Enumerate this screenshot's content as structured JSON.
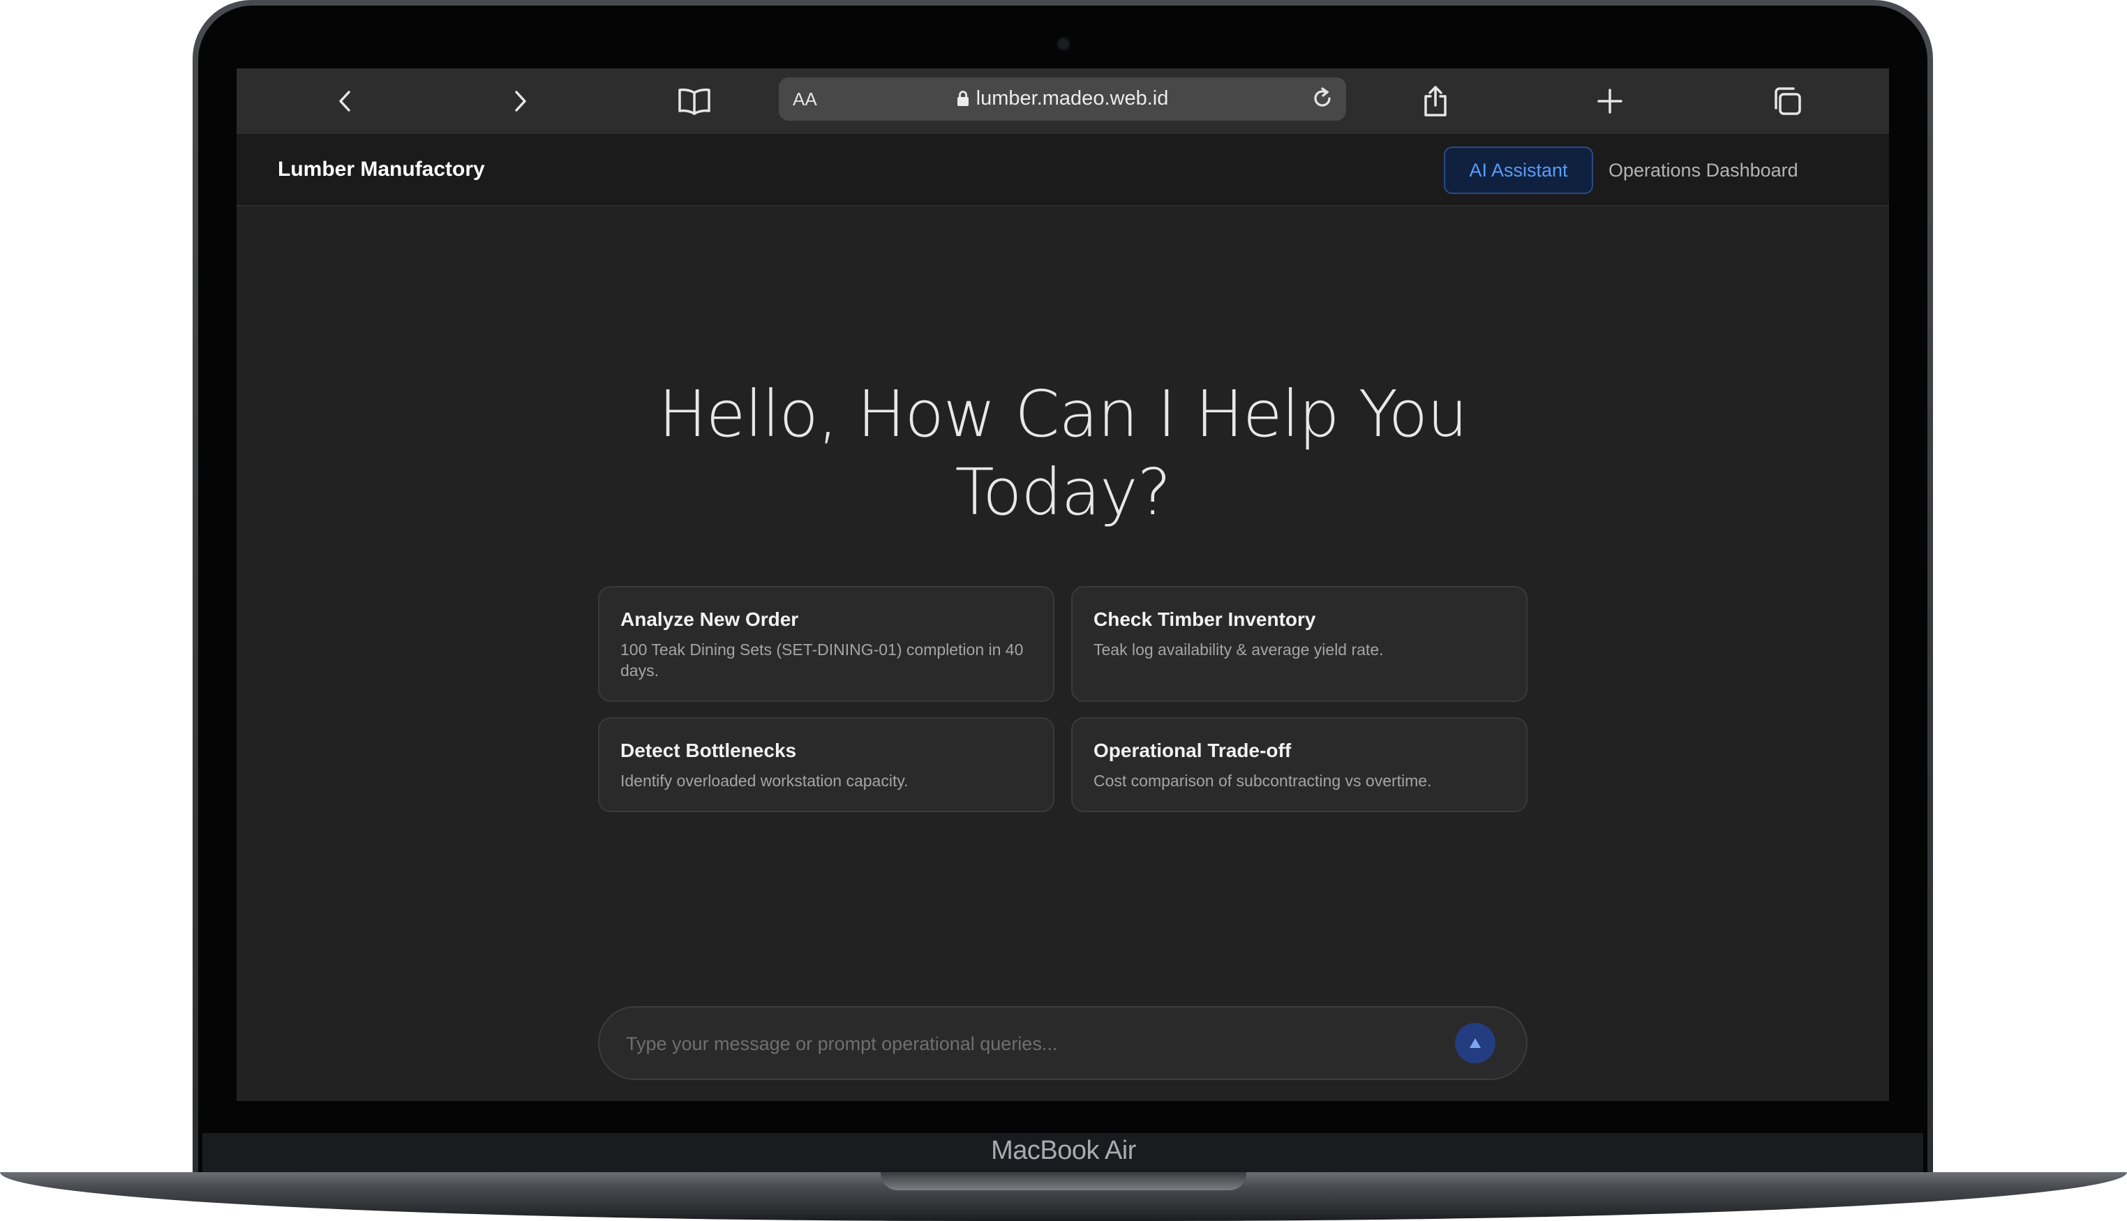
{
  "browser": {
    "text_size_label": "AA",
    "url": "lumber.madeo.web.id",
    "icons": [
      "back-icon",
      "forward-icon",
      "bookmarks-icon",
      "lock-icon",
      "reload-icon",
      "share-icon",
      "new-tab-icon",
      "tabs-icon"
    ]
  },
  "app": {
    "brand": "Lumber Manufactory",
    "nav": {
      "ai_assistant": "AI Assistant",
      "operations_dashboard": "Operations Dashboard"
    },
    "accent_color": "#5a9cf8"
  },
  "main": {
    "greeting_line1": "Hello, How Can I Help You",
    "greeting_line2": "Today?",
    "suggestions": [
      {
        "title": "Analyze New Order",
        "desc": "100 Teak Dining Sets (SET-DINING-01) completion in 40 days."
      },
      {
        "title": "Check Timber Inventory",
        "desc": "Teak log availability & average yield rate."
      },
      {
        "title": "Detect Bottlenecks",
        "desc": "Identify overloaded workstation capacity."
      },
      {
        "title": "Operational Trade-off",
        "desc": "Cost comparison of subcontracting vs overtime."
      }
    ],
    "composer": {
      "placeholder": "Type your message or prompt operational queries...",
      "value": "",
      "send_icon": "send-arrow-icon"
    }
  },
  "device": {
    "label": "MacBook Air"
  }
}
